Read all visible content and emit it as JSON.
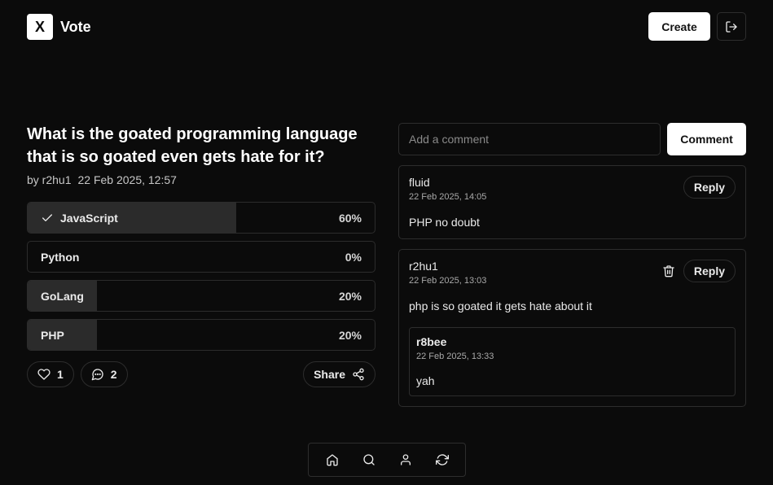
{
  "header": {
    "logo_letter": "X",
    "logo_text": "Vote",
    "create_label": "Create",
    "logout_icon": "logout-icon"
  },
  "poll": {
    "title": "What is the goated programming language that is so goated even gets hate for it?",
    "author": "by r2hu1",
    "date": "22 Feb 2025, 12:57",
    "options": [
      {
        "label": "JavaScript",
        "percent": "60%",
        "fraction": 0.6,
        "selected": true
      },
      {
        "label": "Python",
        "percent": "0%",
        "fraction": 0.0,
        "selected": false
      },
      {
        "label": "GoLang",
        "percent": "20%",
        "fraction": 0.2,
        "selected": false
      },
      {
        "label": "PHP",
        "percent": "20%",
        "fraction": 0.2,
        "selected": false
      }
    ],
    "likes": "1",
    "comments_count": "2",
    "share_label": "Share"
  },
  "comments": {
    "placeholder": "Add a comment",
    "submit_label": "Comment",
    "reply_label": "Reply",
    "items": [
      {
        "author": "fluid",
        "time": "22 Feb 2025, 14:05",
        "text": "PHP no doubt",
        "can_delete": false
      },
      {
        "author": "r2hu1",
        "time": "22 Feb 2025, 13:03",
        "text": "php is so goated it gets hate about it",
        "can_delete": true,
        "replies": [
          {
            "author": "r8bee",
            "time": "22 Feb 2025, 13:33",
            "text": "yah"
          }
        ]
      }
    ]
  },
  "bottom_nav": [
    "home-icon",
    "search-icon",
    "user-icon",
    "refresh-icon"
  ],
  "colors": {
    "background": "#0b0b0b",
    "border": "#2d2d2d",
    "fill": "#2b2b2b",
    "primary_button": "#ffffff"
  }
}
